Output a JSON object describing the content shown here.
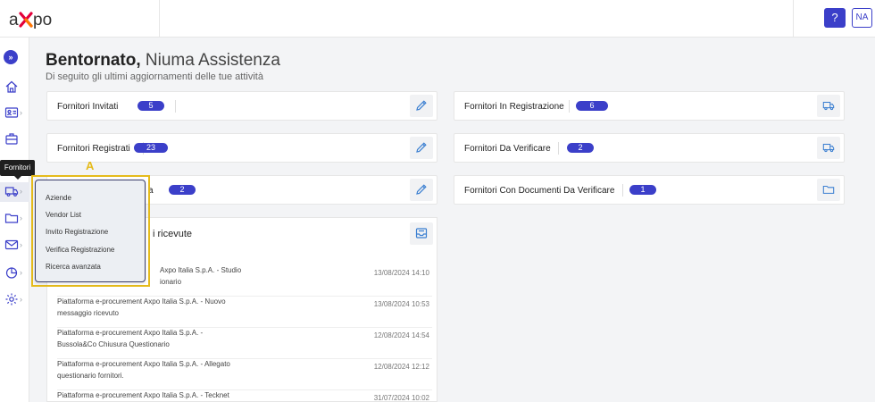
{
  "brand": {
    "logo_text": "axpo",
    "accent": "#3b3fc9",
    "highlight": "#e5bb1c"
  },
  "topbar": {
    "help_label": "?",
    "user_initials": "NA"
  },
  "sidebar": {
    "tooltip": "Fornitori",
    "items": [
      {
        "icon": "home-icon"
      },
      {
        "icon": "contact-card-icon"
      },
      {
        "icon": "briefcase-icon"
      },
      {
        "icon": "truck-icon"
      },
      {
        "icon": "folder-icon"
      },
      {
        "icon": "mail-icon"
      },
      {
        "icon": "chart-pie-icon"
      },
      {
        "icon": "gear-icon"
      }
    ]
  },
  "header": {
    "greeting": "Bentornato,",
    "name": "Niuma Assistenza",
    "subtitle": "Di seguito gli ultimi aggiornamenti delle tue attività"
  },
  "cards": {
    "left": [
      {
        "label": "Fornitori Invitati",
        "count": "5",
        "icon": "pencil-icon"
      },
      {
        "label": "Fornitori Registrati",
        "count": "23",
        "icon": "pencil-icon"
      },
      {
        "label": "a",
        "count": "2",
        "icon": "pencil-icon"
      }
    ],
    "right": [
      {
        "label": "Fornitori In Registrazione",
        "count": "6",
        "icon": "truck-icon"
      },
      {
        "label": "Fornitori Da Verificare",
        "count": "2",
        "icon": "truck-icon"
      },
      {
        "label": "Fornitori Con Documenti Da Verificare",
        "count": "1",
        "icon": "folder-icon"
      }
    ]
  },
  "messages": {
    "title": "i ricevute",
    "items": [
      {
        "text": "Axpo Italia S.p.A. - Studio\nionario",
        "date": "13/08/2024 14:10"
      },
      {
        "text": "Piattaforma e-procurement Axpo Italia S.p.A. - Nuovo\nmessaggio ricevuto",
        "date": "13/08/2024 10:53"
      },
      {
        "text": "Piattaforma e-procurement Axpo Italia S.p.A. -\nBussola&Co Chiusura Questionario",
        "date": "12/08/2024 14:54"
      },
      {
        "text": "Piattaforma e-procurement Axpo Italia S.p.A. - Allegato\nquestionario fornitori.",
        "date": "12/08/2024 12:12"
      },
      {
        "text": "Piattaforma e-procurement Axpo Italia S.p.A. - Tecknet",
        "date": "31/07/2024 10:02"
      }
    ]
  },
  "dropdown": {
    "badge": "A",
    "items": [
      "Aziende",
      "Vendor List",
      "Invito Registrazione",
      "Verifica Registrazione",
      "Ricerca avanzata"
    ]
  }
}
